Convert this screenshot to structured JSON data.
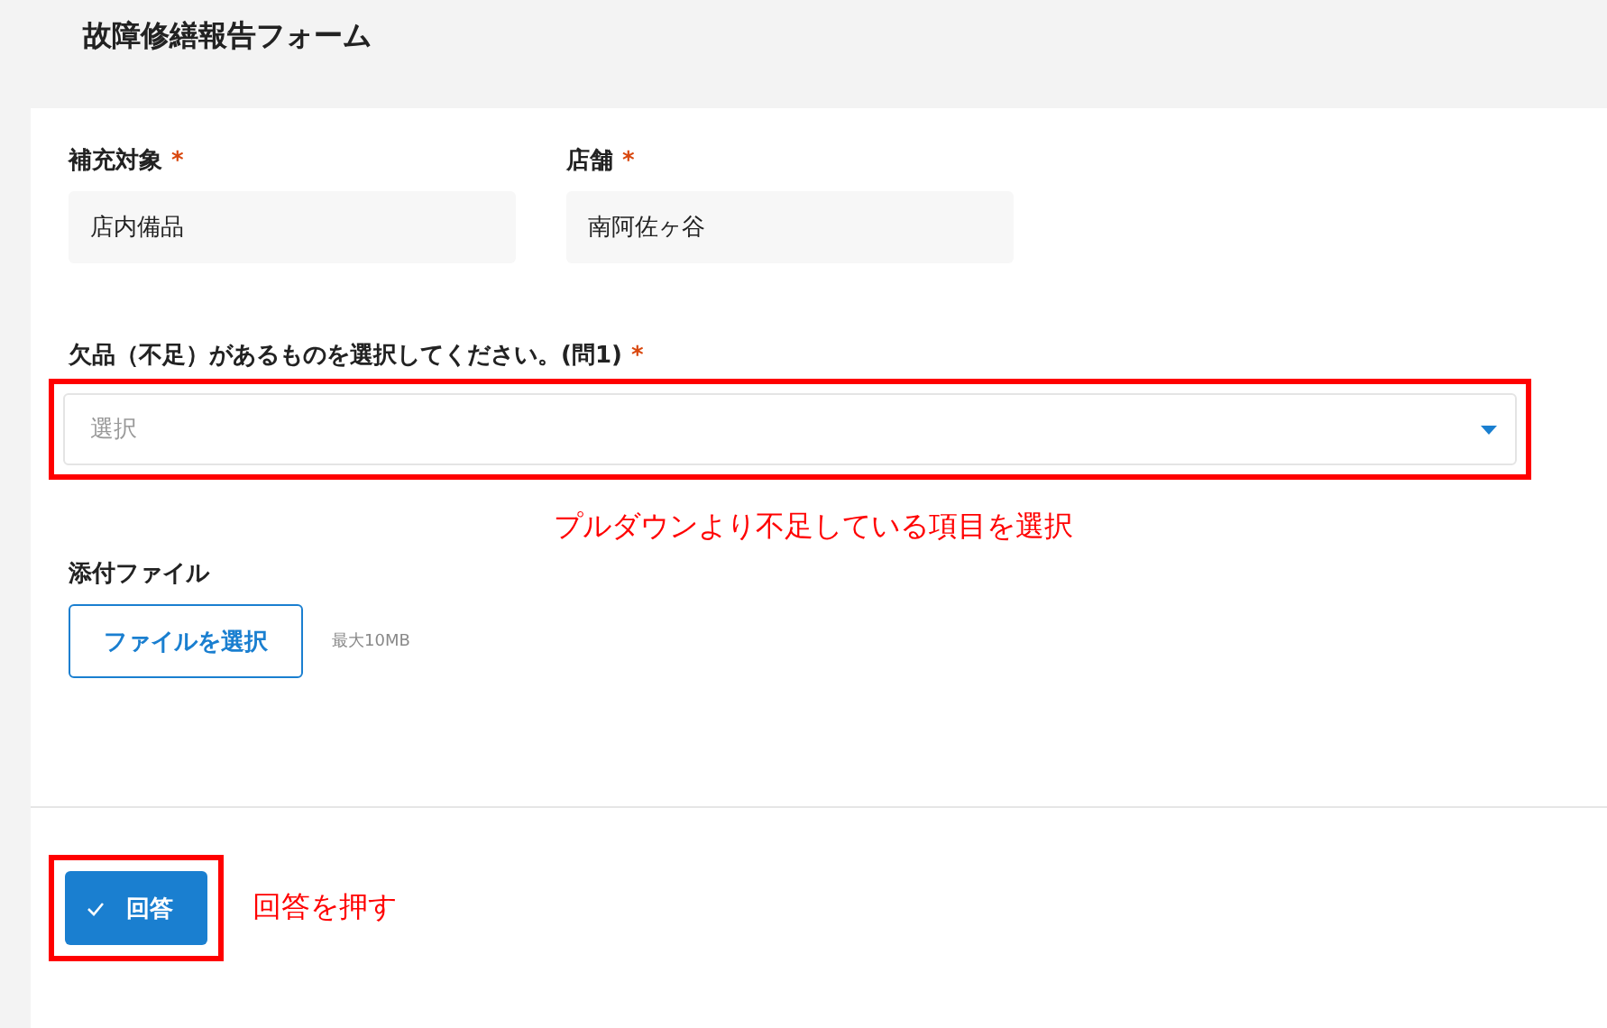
{
  "title": "故障修繕報告フォーム",
  "fields": [
    {
      "label": "補充対象",
      "required_mark": "*",
      "value": "店内備品"
    },
    {
      "label": "店舗",
      "required_mark": "*",
      "value": "南阿佐ヶ谷"
    }
  ],
  "question": {
    "label": "欠品（不足）があるものを選択してください。(問1)",
    "required_mark": "*",
    "placeholder": "選択",
    "highlighted": true,
    "note": "プルダウンより不足している項目を選択"
  },
  "attachment": {
    "label": "添付ファイル",
    "button": "ファイルを選択",
    "hint": "最大10MB"
  },
  "submit": {
    "label": "回答",
    "highlighted": true,
    "note": "回答を押す"
  }
}
